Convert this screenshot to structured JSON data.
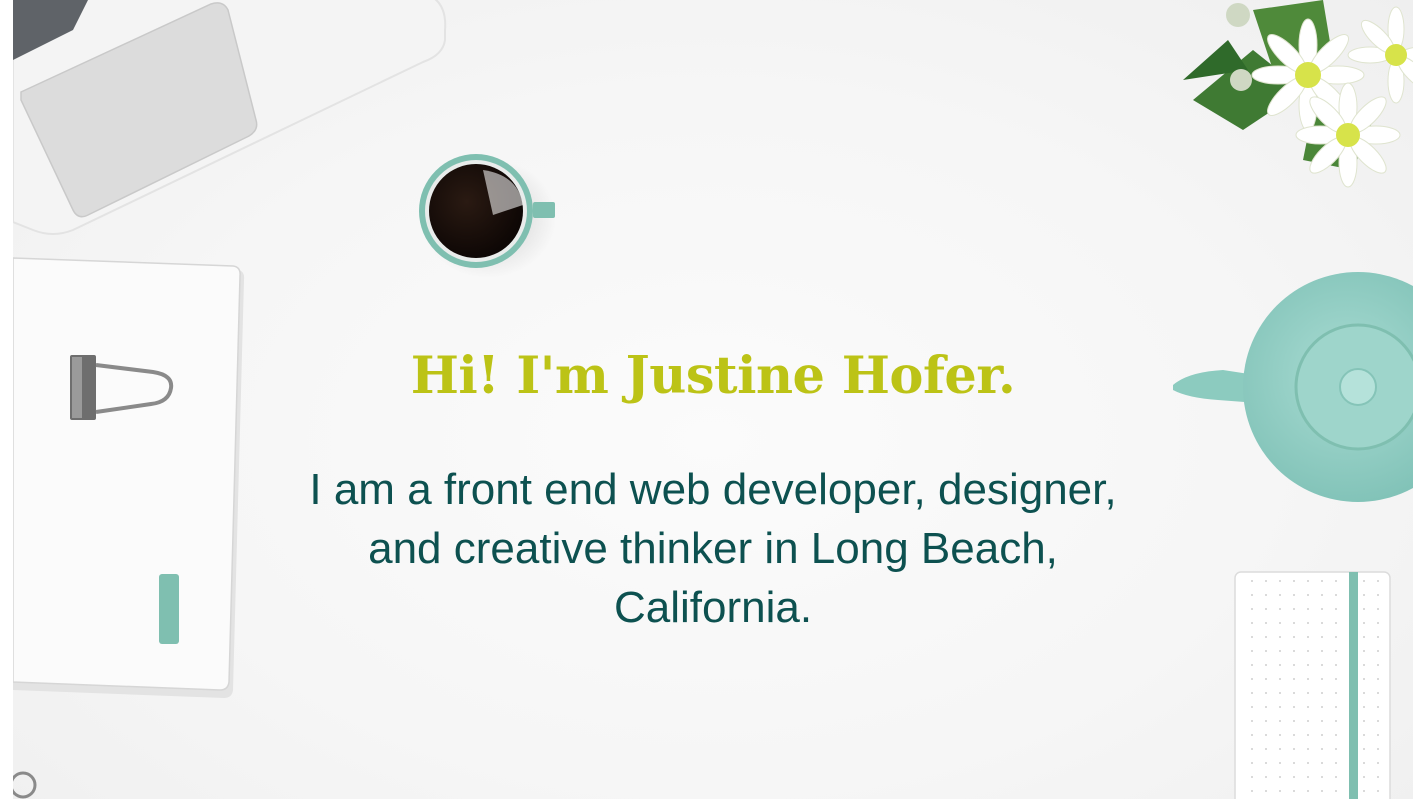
{
  "hero": {
    "title": "Hi! I'm Justine Hofer.",
    "subtitle": "I am a front end web developer, designer, and creative thinker in Long Beach, California."
  },
  "colors": {
    "title": "#bcc316",
    "subtitle": "#0d5150",
    "accent_teal": "#7fbfb0",
    "background": "#f5f5f5"
  },
  "decor_icons": [
    "laptop-icon",
    "coffee-cup-icon",
    "flowers-icon",
    "notebook-clip-icon",
    "teapot-icon",
    "dotted-notebook-icon"
  ]
}
